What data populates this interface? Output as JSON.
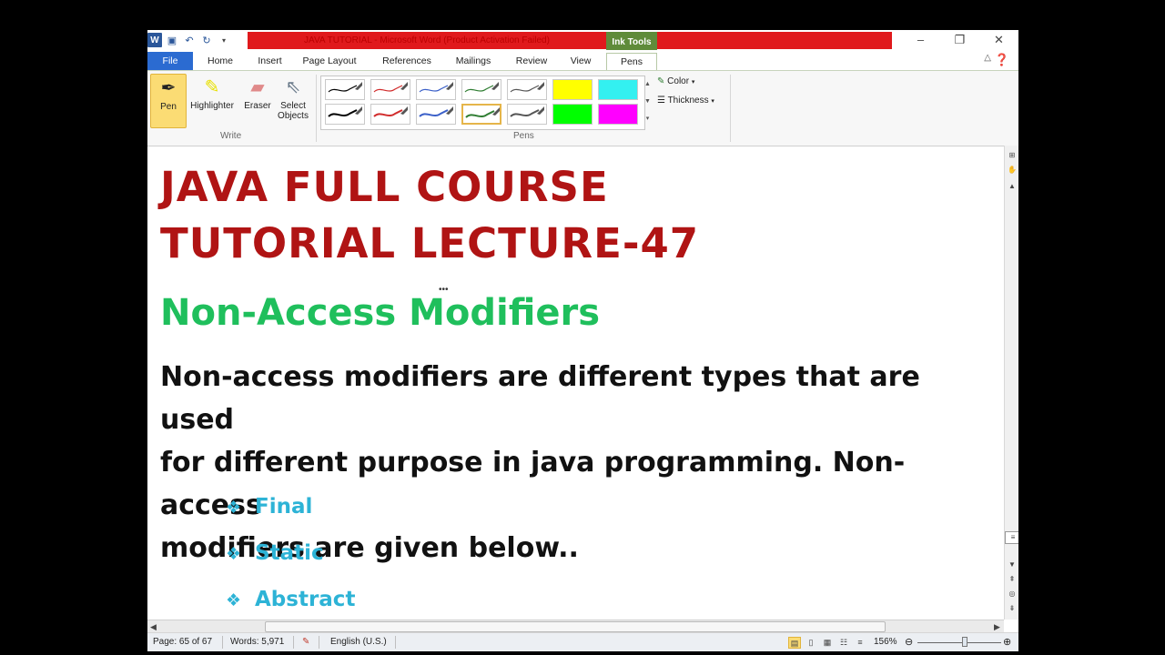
{
  "window": {
    "title": "JAVA TUTORIAL - Microsoft Word (Product Activation Failed)",
    "contextual_tab": "Ink Tools",
    "controls": [
      "–",
      "❐",
      "✕"
    ]
  },
  "tabs": [
    "File",
    "Home",
    "Insert",
    "Page Layout",
    "References",
    "Mailings",
    "Review",
    "View",
    "Pens"
  ],
  "active_tab": "Pens",
  "ribbon": {
    "write_group": {
      "label": "Write",
      "buttons": [
        "Pen",
        "Highlighter",
        "Eraser",
        "Select Objects"
      ]
    },
    "pens_group": {
      "label": "Pens",
      "pens_row1": [
        "#000000",
        "#d12b2b",
        "#3a5fc8",
        "#2f7d32",
        "#555555",
        "#ffff00",
        "#33f0f0"
      ],
      "pens_row2": [
        "#000000",
        "#d12b2b",
        "#3a5fc8",
        "#2f7d32",
        "#555555",
        "#00ff00",
        "#ff00ff"
      ]
    },
    "color_label": "Color",
    "thickness_label": "Thickness"
  },
  "document": {
    "title_line1": "JAVA FULL COURSE",
    "title_line2": "TUTORIAL LECTURE-47",
    "heading": "Non-Access Modifiers",
    "body_line1": "Non-access modifiers are different types that are used",
    "body_line2": "for different purpose in java programming. Non-access",
    "body_line3": "modifiers are given below..",
    "bullets": [
      "Final",
      "Static",
      "Abstract"
    ]
  },
  "status": {
    "page": "Page: 65 of 67",
    "words": "Words: 5,971",
    "language": "English (U.S.)",
    "zoom": "156%"
  },
  "colors": {
    "title_red": "#b01414",
    "heading_green": "#1fbf5c",
    "bullet_blue": "#2db3d6",
    "file_tab_blue": "#2b6bd1",
    "ink_tools_green": "#5f8b3a"
  }
}
